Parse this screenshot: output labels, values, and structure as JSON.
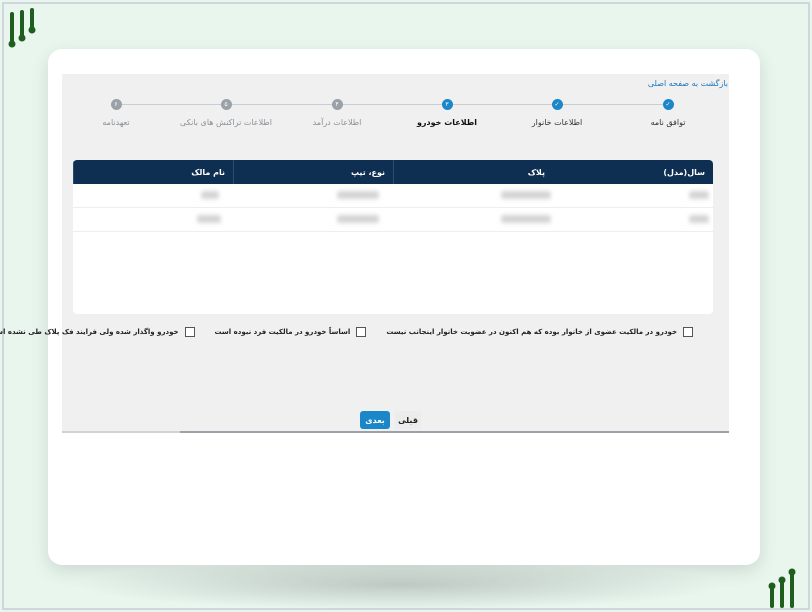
{
  "header": {
    "back_link": "بازگشت به صفحه اصلی"
  },
  "steps": [
    {
      "number": "۱",
      "label": "توافق نامه",
      "status": "done"
    },
    {
      "number": "۲",
      "label": "اطلاعات خانوار",
      "status": "done"
    },
    {
      "number": "۳",
      "label": "اطلاعات خودرو",
      "status": "active"
    },
    {
      "number": "۴",
      "label": "اطلاعات درآمد",
      "status": "todo"
    },
    {
      "number": "۵",
      "label": "اطلاعات تراکنش های بانکی",
      "status": "todo"
    },
    {
      "number": "۶",
      "label": "تعهدنامه",
      "status": "todo"
    }
  ],
  "table": {
    "columns": [
      "نام مالک",
      "نوع، تیپ",
      "پلاک",
      "سال(مدل)"
    ]
  },
  "checkboxes": [
    {
      "label": "خودرو در مالکیت عضوی از خانوار بوده که هم اکنون در عضویت خانوار اینجانب نیست",
      "checked": false
    },
    {
      "label": "اساساً خودرو در مالکیت فرد نبوده است",
      "checked": false
    },
    {
      "label": "خودرو واگذار شده ولی فرایند فک پلاک طی نشده است",
      "checked": false
    }
  ],
  "buttons": {
    "next": "بعدی",
    "prev": "قبلی"
  },
  "colors": {
    "primary": "#1b87c9",
    "table_header": "#0f2f52",
    "background": "#e8f6ee"
  }
}
